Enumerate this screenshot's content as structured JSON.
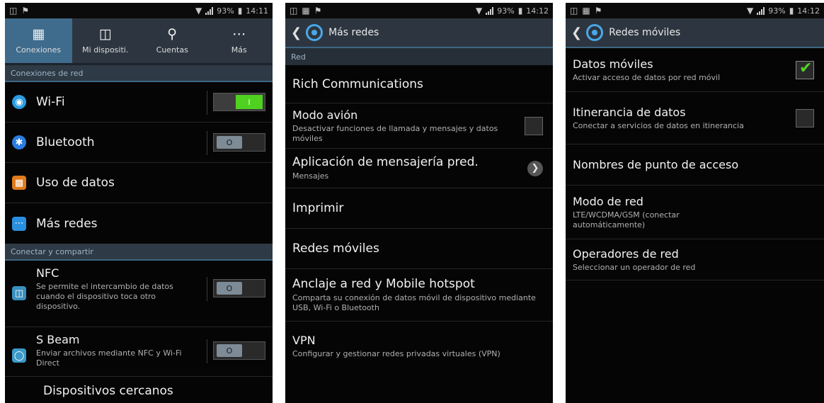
{
  "status": [
    {
      "time": "14:11",
      "battery": "93%"
    },
    {
      "time": "14:12",
      "battery": "93%"
    },
    {
      "time": "14:12",
      "battery": "93%"
    }
  ],
  "screen1": {
    "tabs": [
      {
        "label": "Conexiones",
        "icon": "connections-icon"
      },
      {
        "label": "Mi dispositi.",
        "icon": "my-device-icon"
      },
      {
        "label": "Cuentas",
        "icon": "accounts-icon"
      },
      {
        "label": "Más",
        "icon": "more-icon"
      }
    ],
    "section1": "Conexiones de red",
    "section2": "Conectar y compartir",
    "items": {
      "wifi": "Wi-Fi",
      "bluetooth": "Bluetooth",
      "data_usage": "Uso de datos",
      "more_networks": "Más redes",
      "nfc_title": "NFC",
      "nfc_sub": "Se permite el intercambio de datos cuando el dispositivo toca otro dispositivo.",
      "sbeam_title": "S Beam",
      "sbeam_sub": "Enviar archivos mediante NFC y Wi-Fi Direct",
      "nearby": "Dispositivos cercanos"
    },
    "toggle_on_label": "I",
    "toggle_off_label": "O"
  },
  "screen2": {
    "title": "Más redes",
    "section": "Red",
    "rcs": "Rich Communications",
    "airplane_title": "Modo avión",
    "airplane_sub": "Desactivar funciones de llamada y mensajes y datos móviles",
    "messaging_title": "Aplicación de mensajería pred.",
    "messaging_sub": "Mensajes",
    "print": "Imprimir",
    "mobile_networks": "Redes móviles",
    "tethering_title": "Anclaje a red y Mobile hotspot",
    "tethering_sub": "Comparta su conexión de datos móvil de dispositivo mediante USB, Wi-Fi o Bluetooth",
    "vpn_title": "VPN",
    "vpn_sub": "Configurar y gestionar redes privadas virtuales (VPN)"
  },
  "screen3": {
    "title": "Redes móviles",
    "mobile_data_title": "Datos móviles",
    "mobile_data_sub": "Activar acceso de datos por red móvil",
    "mobile_data_checked": true,
    "roaming_title": "Itinerancia de datos",
    "roaming_sub": "Conectar a servicios de datos en itinerancia",
    "roaming_checked": false,
    "apn": "Nombres de punto de acceso",
    "network_mode_title": "Modo de red",
    "network_mode_sub": "LTE/WCDMA/GSM (conectar automáticamente)",
    "operators_title": "Operadores de red",
    "operators_sub": "Seleccionar un operador de red"
  },
  "colors": {
    "accent": "#3e6684",
    "toggle_on": "#4fd11f",
    "check": "#53d12a"
  }
}
